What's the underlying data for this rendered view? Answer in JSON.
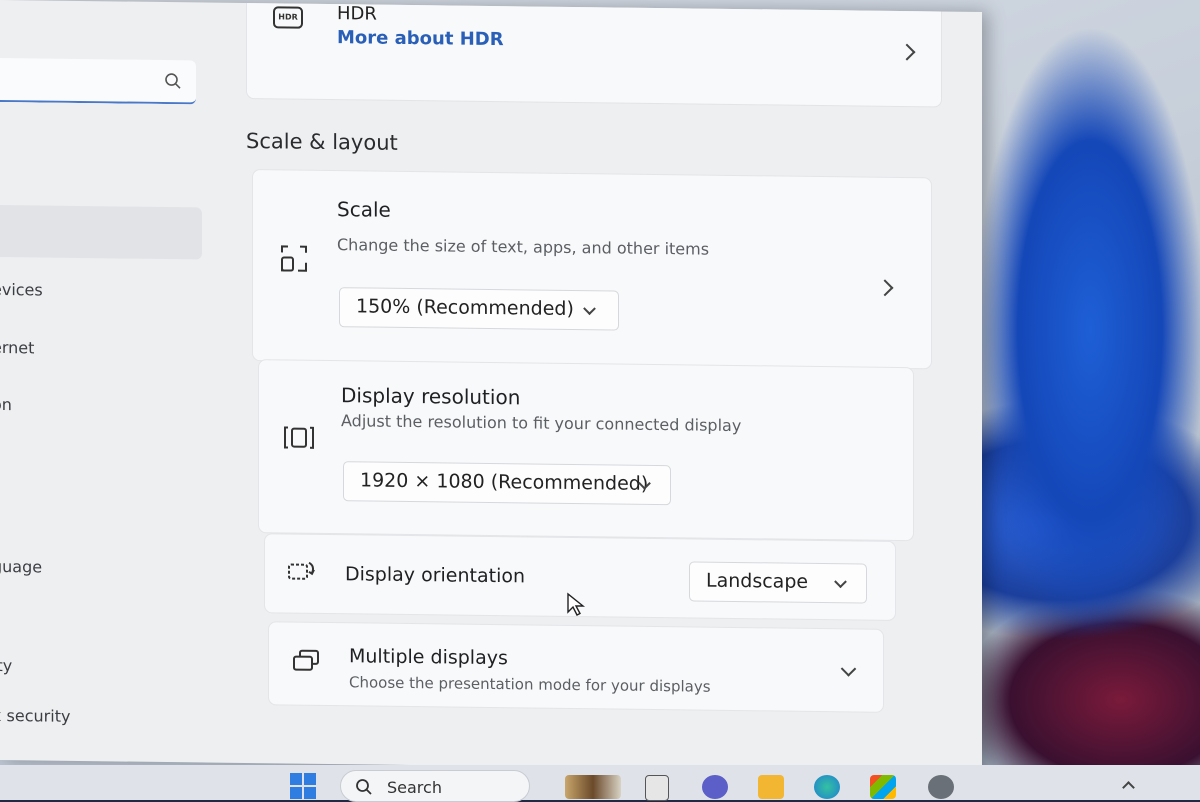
{
  "sidebar": {
    "search": {
      "placeholder": ""
    },
    "items": [
      {
        "label": "evices"
      },
      {
        "label": "ernet"
      },
      {
        "label": "on"
      },
      {
        "label": "guage"
      },
      {
        "label": "ity"
      },
      {
        "label": "x security"
      }
    ]
  },
  "hdr": {
    "title": "HDR",
    "link": "More about HDR"
  },
  "section": {
    "title": "Scale & layout"
  },
  "scale": {
    "title": "Scale",
    "desc": "Change the size of text, apps, and other items",
    "value": "150% (Recommended)"
  },
  "resolution": {
    "title": "Display resolution",
    "desc": "Adjust the resolution to fit your connected display",
    "value": "1920 × 1080 (Recommended)"
  },
  "orientation": {
    "title": "Display orientation",
    "value": "Landscape"
  },
  "multiple": {
    "title": "Multiple displays",
    "desc": "Choose the presentation mode for your displays"
  },
  "taskbar": {
    "search_label": "Search"
  },
  "colors": {
    "accent": "#2a5fb8",
    "window_bg": "#eeeff1",
    "card_bg": "#f8f9fa"
  }
}
